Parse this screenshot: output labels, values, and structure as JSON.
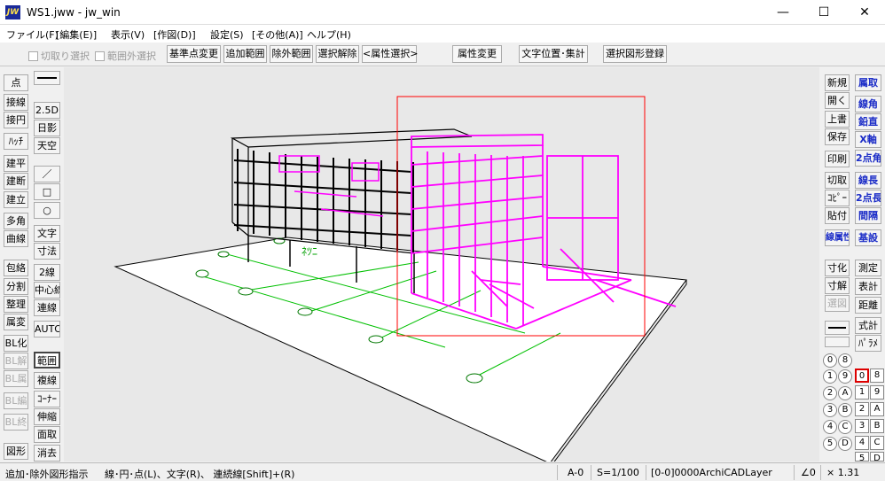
{
  "window": {
    "title": "WS1.jww - jw_win",
    "icon_text": "JW",
    "min": "—",
    "max": "☐",
    "close": "✕"
  },
  "menus": [
    "ファイル(F)",
    "[編集(E)]",
    "表示(V)",
    "[作図(D)]",
    "設定(S)",
    "[その他(A)]",
    "ヘルプ(H)"
  ],
  "toolbar": {
    "checks": [
      "切取り選択",
      "範囲外選択"
    ],
    "buttons": [
      "基準点変更",
      "追加範囲",
      "除外範囲",
      "選択解除",
      "<属性選択>",
      "属性変更",
      "文字位置･集計",
      "選択図形登録"
    ]
  },
  "left_col1": [
    "点",
    "接線",
    "接円",
    "ﾊｯﾁ",
    "建平",
    "建断",
    "建立",
    "多角",
    "曲線",
    "包絡",
    "分割",
    "整理",
    "属変",
    "BL化",
    "BL解",
    "BL属",
    "BL編",
    "BL終",
    "図形"
  ],
  "left_col2": [
    "2.5D",
    "日影",
    "天空",
    "／",
    "□",
    "○",
    "文字",
    "寸法",
    "2線",
    "中心線",
    "連線",
    "AUTO",
    "範囲",
    "複線",
    "ｺｰﾅｰ",
    "伸縮",
    "面取",
    "消去"
  ],
  "right_col1": [
    "新規",
    "開く",
    "上書",
    "保存",
    "印刷",
    "切取",
    "ｺﾋﾟｰ",
    "貼付",
    "線属性",
    "寸化",
    "寸解",
    "選図",
    "測定",
    "表計",
    "距離",
    "式計",
    "ﾊﾟﾗﾒ"
  ],
  "right_col2": [
    "属取",
    "線角",
    "鉛直",
    "X軸",
    "2点角",
    "線長",
    "2点長",
    "間隔",
    "基設"
  ],
  "layers_circle": [
    "0",
    "8",
    "1",
    "9",
    "2",
    "A",
    "3",
    "B",
    "4",
    "C",
    "5",
    "D"
  ],
  "layers_square": [
    "0",
    "8",
    "1",
    "9",
    "2",
    "A",
    "3",
    "B",
    "4",
    "C",
    "5",
    "D"
  ],
  "status": {
    "message": "追加･除外図形指示",
    "hint": "線･円･点(L)、文字(R)、 連続線[Shift]+(R)",
    "layer": "A-0",
    "scale": "S=1/100",
    "layername": "[0-0]0000ArchiCADLayer",
    "angle": "∠0",
    "zoom": "× 1.31"
  },
  "colors": {
    "selected": "#ff00ff",
    "grid": "#00c000",
    "frame": "#ff0000",
    "blue_text": "#1b2cc7"
  }
}
